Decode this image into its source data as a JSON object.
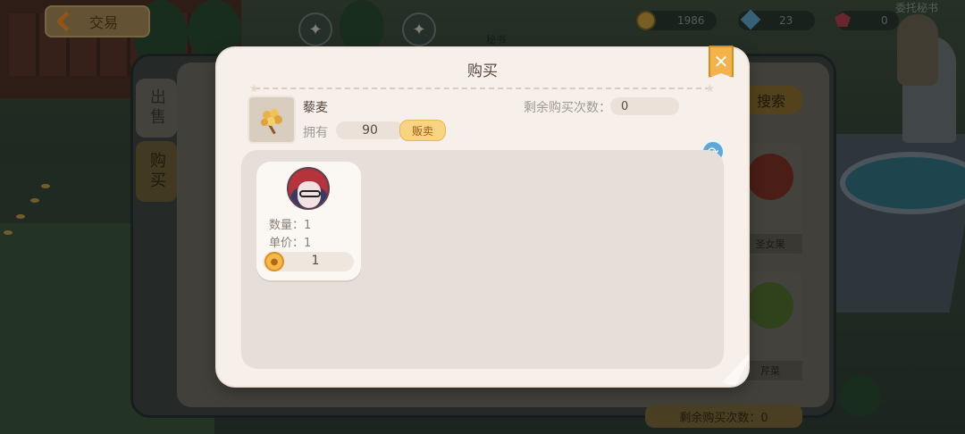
{
  "hud": {
    "back_label": "交易",
    "coins": "1986",
    "blue_gems": "23",
    "red_gems": "0",
    "npc_name": "秘书",
    "secretary_label": "委托秘书"
  },
  "trade_panel": {
    "tab_sell": "出售",
    "tab_buy": "购买",
    "search_label": "搜索",
    "shelf_items": [
      "圣女果",
      "芹菜"
    ],
    "bottom_remaining": "剩余购买次数：0"
  },
  "modal": {
    "title": "购买",
    "close_glyph": "✕",
    "item": {
      "name": "藜麦",
      "own_label": "拥有",
      "own_count": "90",
      "sell_label": "贩卖"
    },
    "remaining_label": "剩余购买次数：",
    "remaining_value": "0",
    "listings": [
      {
        "quantity_label": "数量：1",
        "price_label": "单价：1",
        "total_cost": "1"
      }
    ]
  },
  "icons": {
    "close": "close-icon",
    "refresh": "refresh-icon",
    "coin": "coin-icon",
    "back": "back-arrow-icon"
  },
  "colors": {
    "modal_bg": "#f6efea",
    "accent_gold": "#f3b34a",
    "refresh_blue": "#5fa7d9",
    "sell_button": "#f8d482"
  }
}
